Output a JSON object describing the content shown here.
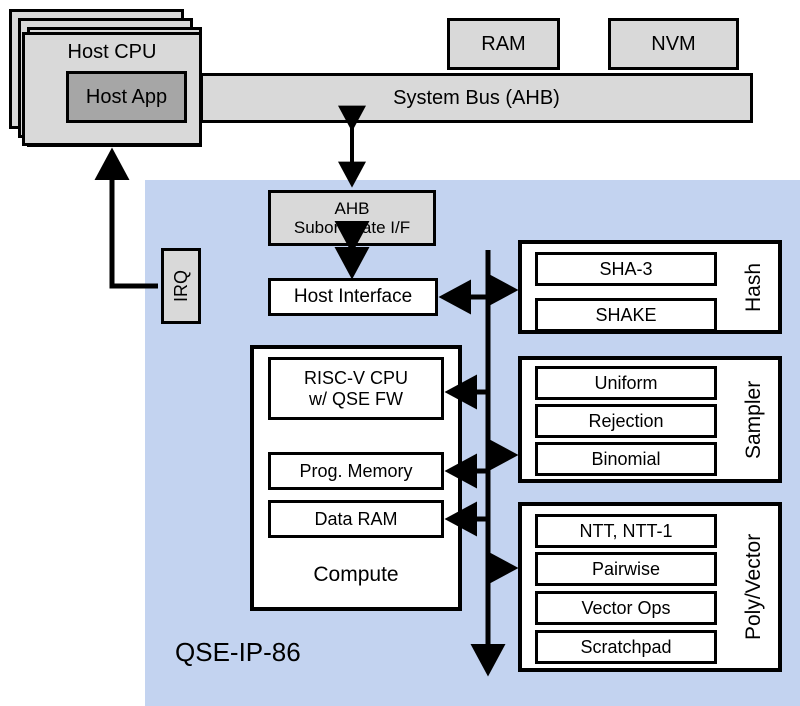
{
  "diagram": {
    "title": "QSE-IP-86",
    "ip_block_label": "QSE-IP-86",
    "colors": {
      "panel_blue": "#c3d3f0",
      "light_gray": "#d9d9d9",
      "dark_gray": "#a6a6a6",
      "white": "#ffffff",
      "outline": "#000000"
    }
  },
  "host": {
    "cpu_label": "Host CPU",
    "app_label": "Host App",
    "stack_count": 4
  },
  "system": {
    "bus_label": "System Bus (AHB)",
    "ram_label": "RAM",
    "nvm_label": "NVM"
  },
  "ip": {
    "ahb_if_label": "AHB\nSubordinate I/F",
    "irq_label": "IRQ",
    "host_interface_label": "Host Interface"
  },
  "compute": {
    "group_label": "Compute",
    "items": [
      {
        "label": "RISC-V CPU\nw/ QSE FW"
      },
      {
        "label": "Prog. Memory"
      },
      {
        "label": "Data RAM"
      }
    ]
  },
  "hash": {
    "group_label": "Hash",
    "items": [
      {
        "label": "SHA-3"
      },
      {
        "label": "SHAKE"
      }
    ]
  },
  "sampler": {
    "group_label": "Sampler",
    "items": [
      {
        "label": "Uniform"
      },
      {
        "label": "Rejection"
      },
      {
        "label": "Binomial"
      }
    ]
  },
  "polyvector": {
    "group_label": "Poly/Vector",
    "items": [
      {
        "label": "NTT, NTT-1"
      },
      {
        "label": "Pairwise"
      },
      {
        "label": "Vector Ops"
      },
      {
        "label": "Scratchpad"
      }
    ]
  }
}
